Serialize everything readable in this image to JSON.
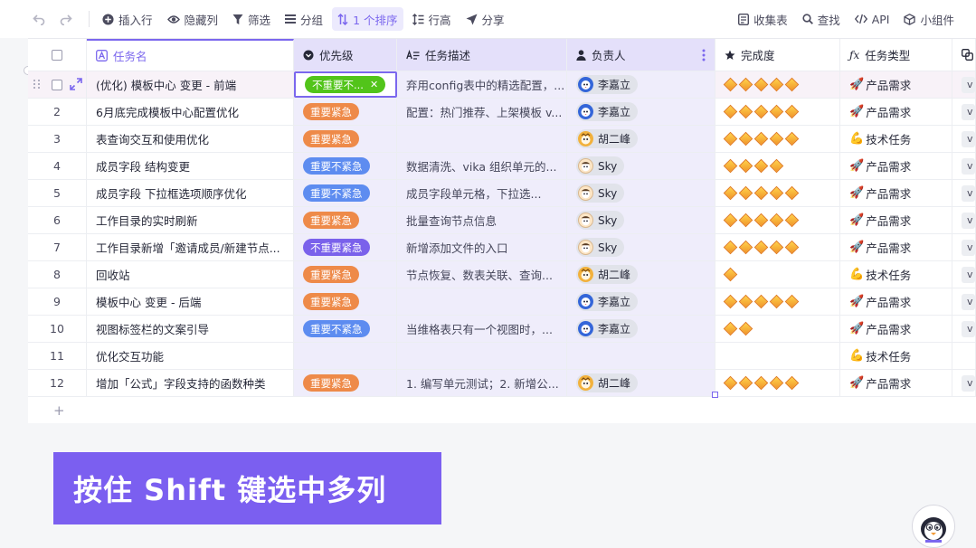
{
  "toolbar": {
    "items": [
      "插入行",
      "隐藏列",
      "筛选",
      "分组",
      "1 个排序",
      "行高",
      "分享"
    ],
    "right": [
      "收集表",
      "查找",
      "API",
      "小组件"
    ]
  },
  "columns": {
    "name": "任务名",
    "priority": "优先级",
    "desc": "任务描述",
    "owner": "负责人",
    "done": "完成度",
    "type": "任务类型"
  },
  "rows": [
    {
      "num": "1",
      "name": "(优化) 模板中心 变更 - 前端",
      "priority": "不重要不...",
      "desc": "弃用config表中的精选配置，...",
      "owner": "李嘉立",
      "stars": 5,
      "type": "产品需求"
    },
    {
      "num": "2",
      "name": "6月底完成模板中心配置优化",
      "priority": "重要紧急",
      "desc": "配置：热门推荐、上架模板 v...",
      "owner": "李嘉立",
      "stars": 5,
      "type": "产品需求"
    },
    {
      "num": "3",
      "name": "表查询交互和使用优化",
      "priority": "重要紧急",
      "desc": "",
      "owner": "胡二峰",
      "stars": 5,
      "type": "技术任务"
    },
    {
      "num": "4",
      "name": "成员字段 结构变更",
      "priority": "重要不紧急",
      "desc": "数据清洗、vika 组织单元的...",
      "owner": "Sky",
      "stars": 4,
      "type": "产品需求"
    },
    {
      "num": "5",
      "name": "成员字段 下拉框选项顺序优化",
      "priority": "重要不紧急",
      "desc": "成员字段单元格，下拉选...",
      "owner": "Sky",
      "stars": 5,
      "type": "产品需求"
    },
    {
      "num": "6",
      "name": "工作目录的实时刷新",
      "priority": "重要紧急",
      "desc": "批量查询节点信息",
      "owner": "Sky",
      "stars": 5,
      "type": "产品需求"
    },
    {
      "num": "7",
      "name": "工作目录新增「邀请成员/新建节点...",
      "priority": "不重要紧急",
      "desc": "新增添加文件的入口",
      "owner": "Sky",
      "stars": 5,
      "type": "产品需求"
    },
    {
      "num": "8",
      "name": "回收站",
      "priority": "重要紧急",
      "desc": "节点恢复、数表关联、查询...",
      "owner": "胡二峰",
      "stars": 1,
      "type": "技术任务"
    },
    {
      "num": "9",
      "name": "模板中心 变更 - 后端",
      "priority": "重要紧急",
      "desc": "",
      "owner": "李嘉立",
      "stars": 5,
      "type": "产品需求"
    },
    {
      "num": "10",
      "name": "视图标签栏的文案引导",
      "priority": "重要不紧急",
      "desc": "当维格表只有一个视图时，...",
      "owner": "李嘉立",
      "stars": 2,
      "type": "产品需求"
    },
    {
      "num": "11",
      "name": "优化交互功能",
      "priority": "",
      "desc": "",
      "owner": "",
      "stars": 0,
      "type": "技术任务"
    },
    {
      "num": "12",
      "name": "增加「公式」字段支持的函数种类",
      "priority": "重要紧急",
      "desc": "1. 编写单元测试；2. 新增公...",
      "owner": "胡二峰",
      "stars": 5,
      "type": "产品需求"
    }
  ],
  "extra_col_text": "v",
  "add_row": "+",
  "caption": "按住 Shift 键选中多列"
}
